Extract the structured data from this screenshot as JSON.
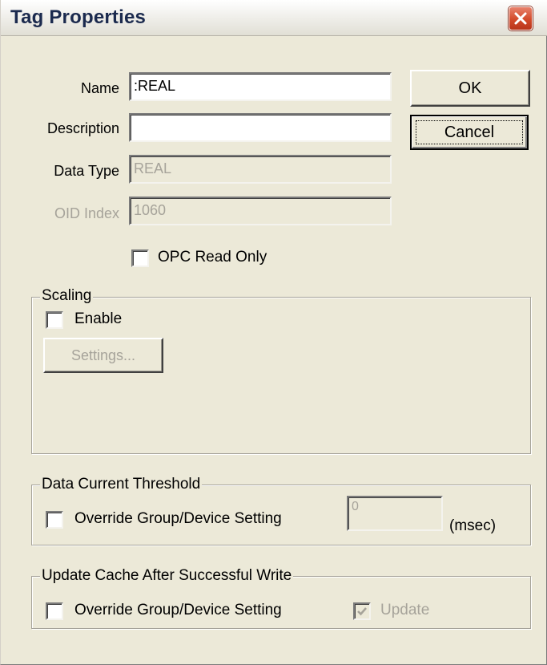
{
  "window": {
    "title": "Tag Properties"
  },
  "fields": {
    "name_label": "Name",
    "name_value": ":REAL",
    "description_label": "Description",
    "description_value": "",
    "data_type_label": "Data Type",
    "data_type_value": "REAL",
    "oid_index_label": "OID Index",
    "oid_index_value": "1060"
  },
  "buttons": {
    "ok": "OK",
    "cancel": "Cancel"
  },
  "opc_read_only": {
    "label": "OPC Read Only",
    "checked": false
  },
  "scaling": {
    "title": "Scaling",
    "enable_label": "Enable",
    "enable_checked": false,
    "settings_button": "Settings..."
  },
  "data_current_threshold": {
    "title": "Data Current Threshold",
    "override_label": "Override Group/Device Setting",
    "override_checked": false,
    "value": "0",
    "unit": "(msec)"
  },
  "update_cache": {
    "title": "Update Cache After Successful Write",
    "override_label": "Override Group/Device Setting",
    "override_checked": false,
    "update_label": "Update",
    "update_checked": true
  },
  "icons": {
    "close": "close-icon",
    "checkmark": "checkmark-icon"
  }
}
